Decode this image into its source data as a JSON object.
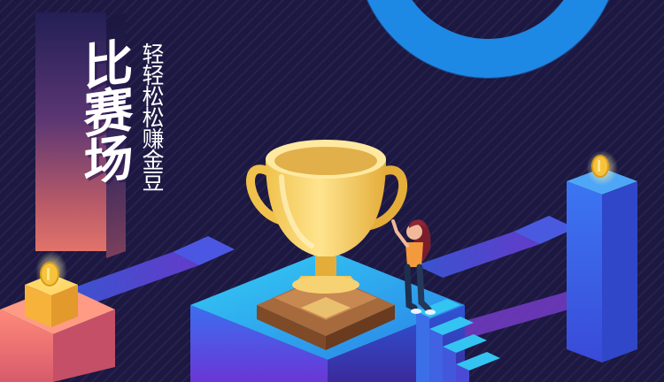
{
  "title": {
    "main": "比赛场",
    "sub": "轻轻松松赚金豆"
  },
  "colors": {
    "background": "#1c1842",
    "ring": "#1e88e5",
    "trophy": "#f5d06a",
    "platform": "#2bb6f0",
    "tower": "#3a63e8",
    "box": "#f4b23c"
  },
  "icons": [
    "trophy-icon",
    "coin-icon",
    "person-icon"
  ]
}
